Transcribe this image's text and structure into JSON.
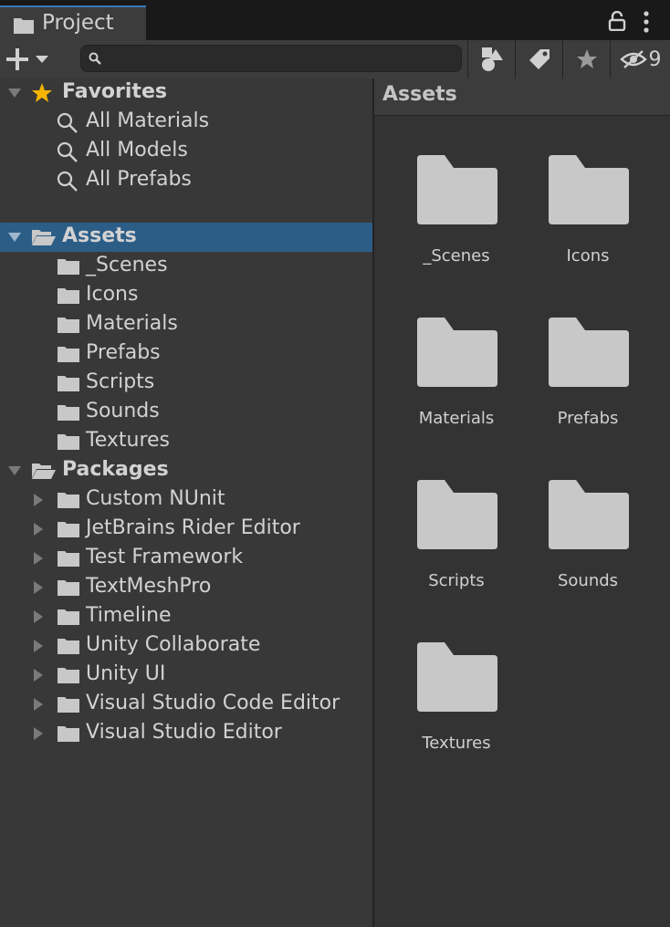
{
  "window": {
    "tab_title": "Project"
  },
  "toolbar": {
    "search_placeholder": "",
    "hidden_count": "9"
  },
  "tree": {
    "favorites": {
      "label": "Favorites",
      "items": [
        "All Materials",
        "All Models",
        "All Prefabs"
      ]
    },
    "assets": {
      "label": "Assets",
      "items": [
        "_Scenes",
        "Icons",
        "Materials",
        "Prefabs",
        "Scripts",
        "Sounds",
        "Textures"
      ]
    },
    "packages": {
      "label": "Packages",
      "items": [
        "Custom NUnit",
        "JetBrains Rider Editor",
        "Test Framework",
        "TextMeshPro",
        "Timeline",
        "Unity Collaborate",
        "Unity UI",
        "Visual Studio Code Editor",
        "Visual Studio Editor"
      ]
    }
  },
  "content": {
    "title": "Assets",
    "items": [
      "_Scenes",
      "Icons",
      "Materials",
      "Prefabs",
      "Scripts",
      "Sounds",
      "Textures"
    ]
  },
  "colors": {
    "selection": "#2c5d87",
    "accent": "#3a79bb",
    "star": "#f4b400",
    "folder": "#c8c8c8"
  }
}
